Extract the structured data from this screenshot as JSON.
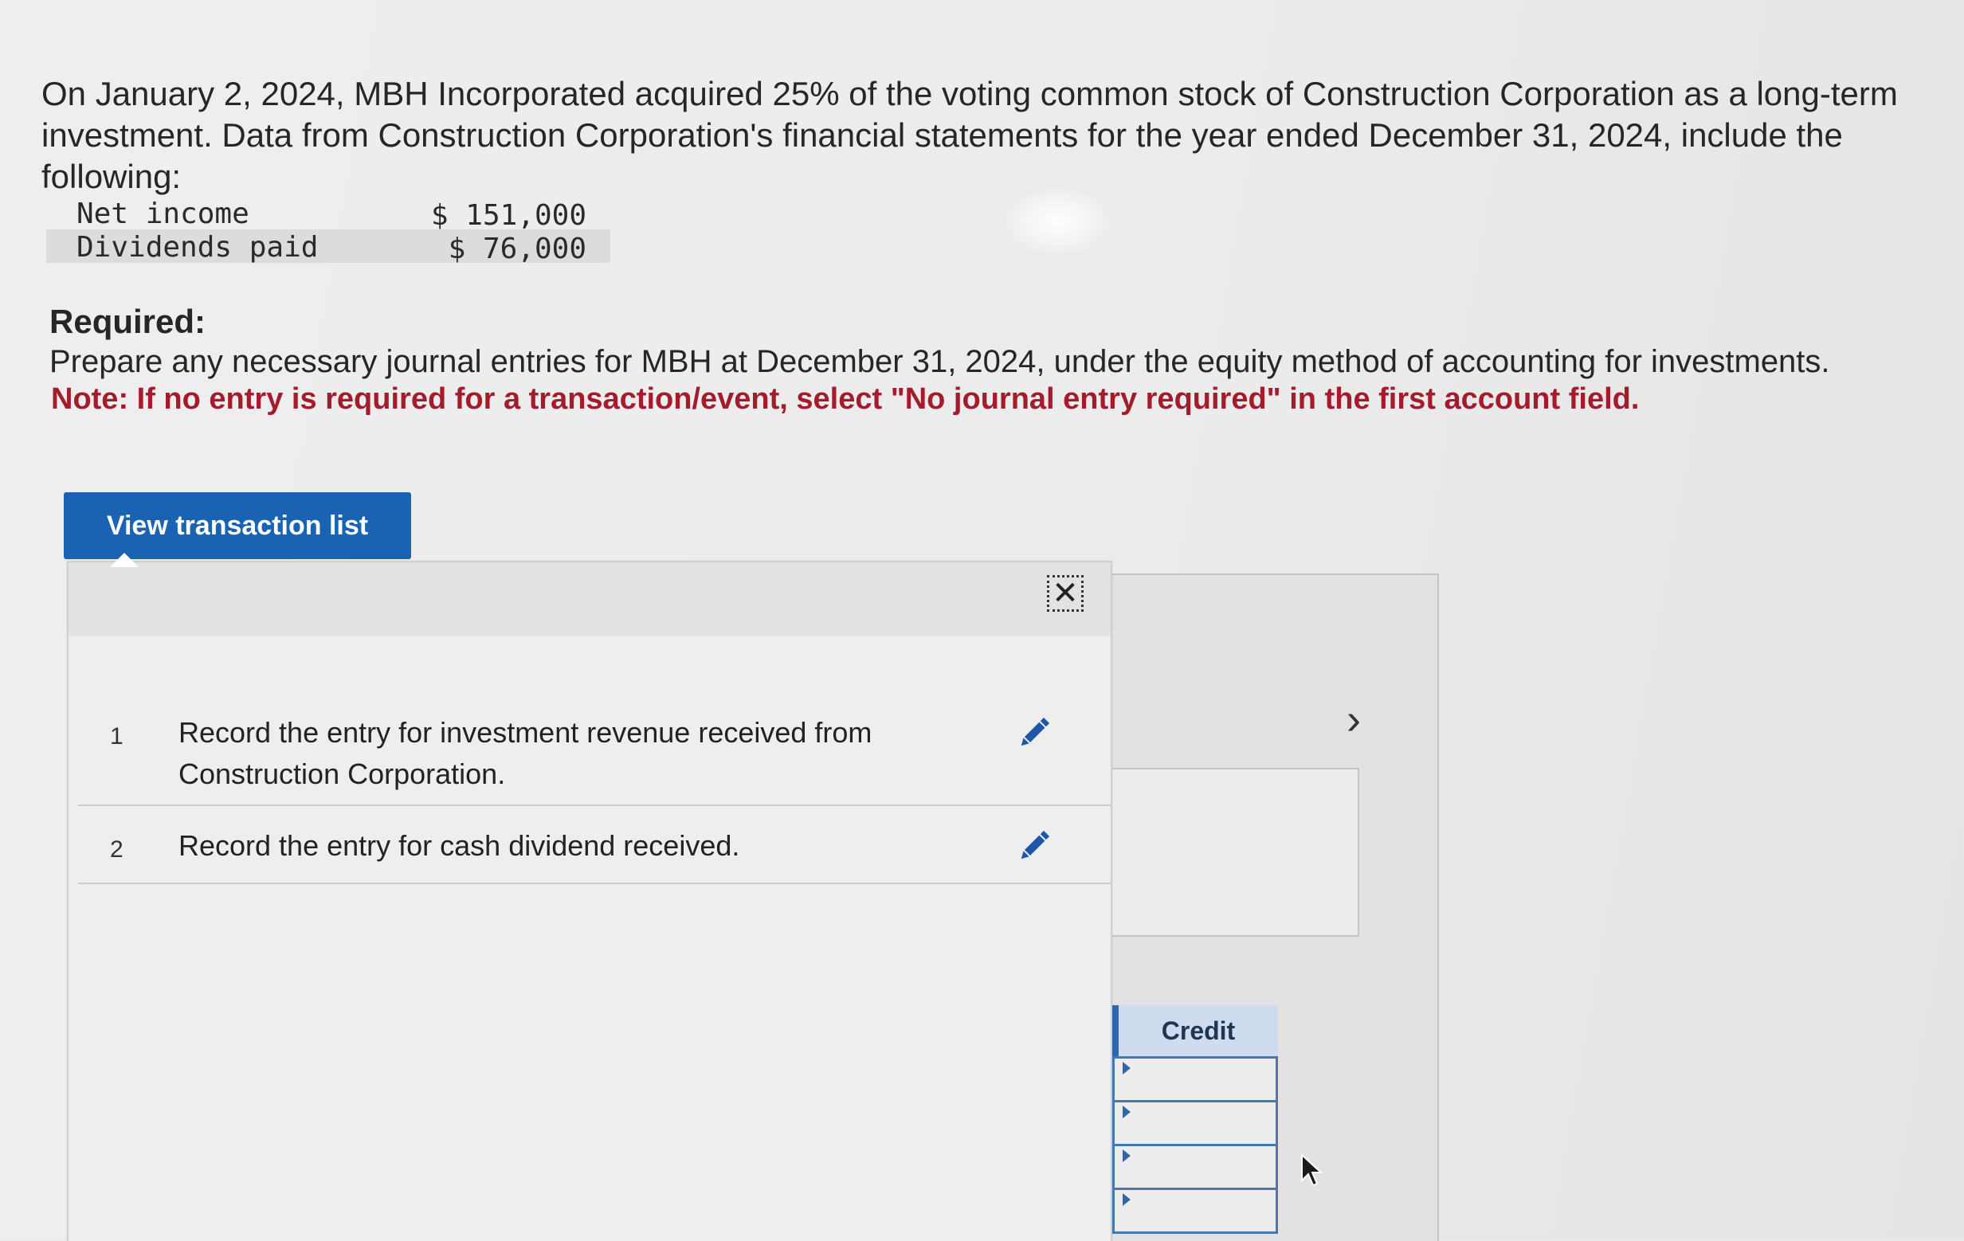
{
  "problem": {
    "intro": "On January 2, 2024, MBH Incorporated acquired 25% of the voting common stock of Construction Corporation as a long-term investment. Data from Construction Corporation's financial statements for the year ended December 31, 2024, include the following:",
    "data_rows": [
      {
        "label": "Net income",
        "value": "$ 151,000"
      },
      {
        "label": "Dividends paid",
        "value": "$ 76,000"
      }
    ],
    "required_title": "Required:",
    "required_text": "Prepare any necessary journal entries for MBH at December 31, 2024, under the equity method of accounting for investments.",
    "note": "Note: If no entry is required for a transaction/event, select \"No journal entry required\" in the first account field."
  },
  "view_button": {
    "label": "View transaction list"
  },
  "transaction_list": {
    "items": [
      {
        "num": "1",
        "text": "Record the entry for investment revenue received from Construction Corporation."
      },
      {
        "num": "2",
        "text": "Record the entry for cash dividend received."
      }
    ]
  },
  "journal": {
    "credit_header": "Credit"
  },
  "colors": {
    "accent": "#1a63b3",
    "note": "#a41b2c"
  }
}
